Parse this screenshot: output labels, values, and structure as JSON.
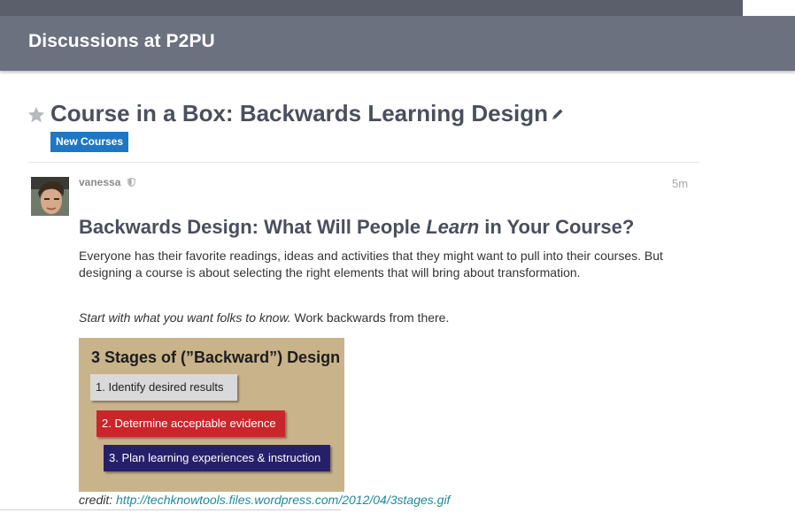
{
  "header": {
    "title": "Discussions at P2PU"
  },
  "topic": {
    "title": "Course in a Box: Backwards Learning Design",
    "category": "New Courses",
    "starred": false
  },
  "post": {
    "username": "vanessa",
    "timestamp": "5m",
    "heading_before": "Backwards Design: What Will People ",
    "heading_em": "Learn",
    "heading_after": " in Your Course?",
    "paragraph1": "Everyone has their favorite readings, ideas and activities that they might want to pull into their courses. But designing a course is about selecting the right elements that will bring about transformation.",
    "paragraph2_em": "Start with what you want folks to know.",
    "paragraph2_rest": " Work backwards from there.",
    "image": {
      "title": "3 Stages of (”Backward”) Design",
      "stage1": "1. Identify desired results",
      "stage2": "2. Determine acceptable evidence",
      "stage3": "3. Plan learning experiences & instruction"
    },
    "credit_label": "credit: ",
    "credit_link": "http://techknowtools.files.wordpress.com/2012/04/3stages.gif"
  },
  "colors": {
    "header_bg": "#6c7180",
    "category_badge": "#1f77c4",
    "link": "#1f8a9a"
  }
}
